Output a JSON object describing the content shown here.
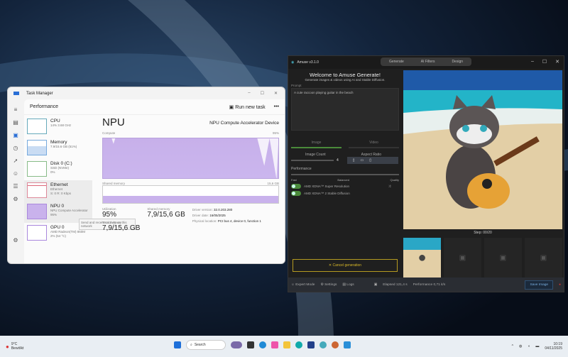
{
  "task_manager": {
    "title": "Task Manager",
    "section": "Performance",
    "run_new_task": "Run new task",
    "more": "•••",
    "items": [
      {
        "name": "CPU",
        "sub": "14% 3.68 GHz"
      },
      {
        "name": "Memory",
        "sub": "7.9/15.6 GB (51%)"
      },
      {
        "name": "Disk 0 (C:)",
        "sub": "SSD (NVMe)",
        "sub2": "0%"
      },
      {
        "name": "Ethernet",
        "sub": "Ethernet",
        "sub2": "S: 0 R: 0 Kbps"
      },
      {
        "name": "NPU 0",
        "sub": "NPU Compute Accelerator",
        "sub2": "95%"
      },
      {
        "name": "GPU 0",
        "sub": "AMD Radeon(TM) 860M",
        "sub2": "2% (54 °C)"
      }
    ],
    "tooltip": "Send and receive activity on this network",
    "heading": "NPU",
    "device": "NPU Compute Accelerator Device",
    "compute_label": "Compute",
    "compute_max": "95%",
    "shared_label": "Shared memory",
    "shared_max": "15,6 GB",
    "utilization_label": "Utilization",
    "utilization": "95%",
    "shared_mem_label": "Shared memory",
    "shared_mem": "7,9/15,6 GB",
    "total_mem_label": "Total memory",
    "total_mem": "7,9/15,6 GB",
    "driver_version_label": "Driver version:",
    "driver_version": "32.0.203.280",
    "driver_date_label": "Driver date:",
    "driver_date": "16/05/2025",
    "location_label": "Physical location:",
    "location": "PCI bus 4, device 0, function 1"
  },
  "amuse": {
    "title": "Amuse v3.1.0",
    "tabs": [
      "Generate",
      "AI Filters",
      "Design"
    ],
    "welcome": "Welcome to Amuse Generate!",
    "subtitle": "Generate images & videos using AI and Stable Diffusion.",
    "prompt_label": "Prompt",
    "prompt": "A cute raccoon playing guitar in the beach",
    "mode_image": "Image",
    "mode_video": "Video",
    "image_count_label": "Image Count",
    "image_count": "4",
    "aspect_label": "Aspect Ratio",
    "performance_label": "Performance",
    "perf_fast": "Fast",
    "perf_balanced": "Balanced",
    "perf_quality": "Quality",
    "toggle1": "AMD XDNA™ Super Resolution",
    "toggle2": "AMD XDNA™ 2 Stable Diffusion",
    "cancel": "✕ Cancel generation",
    "step": "Step: 00/20",
    "expert": "Expert Mode",
    "settings": "Settings",
    "logs": "Logs",
    "elapsed": "Elapsed 121,4 s",
    "performance": "Performance 0,71 it/s",
    "save": "Save Image"
  },
  "taskbar": {
    "temp": "9°C",
    "weather": "Bewölkt",
    "search": "Search",
    "time": "10:19",
    "date": "04/11/2025"
  }
}
